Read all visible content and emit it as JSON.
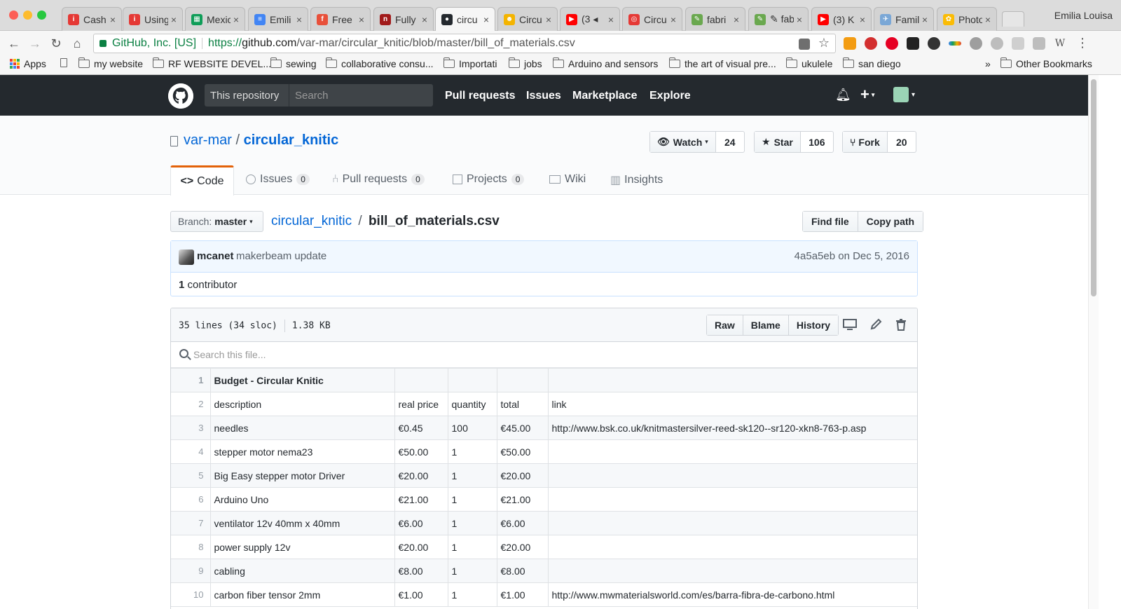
{
  "browser": {
    "profile": "Emilia Louisa",
    "tabs": [
      {
        "label": "Cash",
        "color": "#e53935",
        "glyph": "i"
      },
      {
        "label": "Using",
        "color": "#e53935",
        "glyph": "i"
      },
      {
        "label": "Mexic",
        "color": "#0f9d58",
        "glyph": "▦"
      },
      {
        "label": "Emili",
        "color": "#4285f4",
        "glyph": "≡"
      },
      {
        "label": "Free",
        "color": "#e8503a",
        "glyph": "f"
      },
      {
        "label": "Fully",
        "color": "#a11a1a",
        "glyph": "n"
      },
      {
        "label": "circu",
        "color": "#24292e",
        "glyph": "●",
        "active": true
      },
      {
        "label": "Circu",
        "color": "#f4b400",
        "glyph": "☻"
      },
      {
        "label": "(3 ◂",
        "color": "#ff0000",
        "glyph": "▶"
      },
      {
        "label": "Circu",
        "color": "#e53935",
        "glyph": "◎"
      },
      {
        "label": "fabri",
        "color": "#6aa84f",
        "glyph": "✎"
      },
      {
        "label": "✎ fab",
        "color": "#6aa84f",
        "glyph": "✎"
      },
      {
        "label": "(3) K",
        "color": "#ff0000",
        "glyph": "▶"
      },
      {
        "label": "Famil",
        "color": "#7aa7d6",
        "glyph": "✈"
      },
      {
        "label": "Photo",
        "color": "#fbbc05",
        "glyph": "✿"
      }
    ],
    "secure_label": "GitHub, Inc. [US]",
    "url_scheme": "https://",
    "url_host": "github.com",
    "url_path": "/var-mar/circular_knitic/blob/master/bill_of_materials.csv",
    "bookmarks": [
      "Apps",
      "my website",
      "RF WEBSITE DEVEL...",
      "sewing",
      "collaborative consu...",
      "Importati",
      "jobs",
      "Arduino and sensors",
      "the art of visual pre...",
      "ukulele",
      "san diego"
    ],
    "bookmarks_more": "»",
    "other_bookmarks": "Other Bookmarks"
  },
  "github": {
    "scope": "This repository",
    "search_placeholder": "Search",
    "nav": [
      "Pull requests",
      "Issues",
      "Marketplace",
      "Explore"
    ]
  },
  "repo": {
    "owner": "var-mar",
    "separator": "/",
    "name": "circular_knitic",
    "watch_label": "Watch",
    "watch_count": "24",
    "star_label": "Star",
    "star_count": "106",
    "fork_label": "Fork",
    "fork_count": "20",
    "tabs": {
      "code": "Code",
      "issues": "Issues",
      "issues_count": "0",
      "pulls": "Pull requests",
      "pulls_count": "0",
      "projects": "Projects",
      "projects_count": "0",
      "wiki": "Wiki",
      "insights": "Insights"
    }
  },
  "file": {
    "branch_prefix": "Branch:",
    "branch": "master",
    "breadcrumb_repo": "circular_knitic",
    "breadcrumb_sep": "/",
    "filename": "bill_of_materials.csv",
    "find_file": "Find file",
    "copy_path": "Copy path",
    "commit_author": "mcanet",
    "commit_message": "makerbeam update",
    "commit_sha": "4a5a5eb",
    "commit_date": "on Dec 5, 2016",
    "contributors_count": "1",
    "contributors_label": "contributor",
    "lines_info": "35 lines (34 sloc)",
    "size": "1.38 KB",
    "raw": "Raw",
    "blame": "Blame",
    "history": "History",
    "search_placeholder": "Search this file..."
  },
  "csv": {
    "rows": [
      [
        "1",
        "Budget - Circular Knitic",
        "",
        "",
        "",
        ""
      ],
      [
        "2",
        "description",
        "real price",
        "quantity",
        "total",
        "link"
      ],
      [
        "3",
        "needles",
        "€0.45",
        "100",
        "€45.00",
        "http://www.bsk.co.uk/knitmastersilver-reed-sk120--sr120-xkn8-763-p.asp"
      ],
      [
        "4",
        "stepper motor nema23",
        "€50.00",
        "1",
        "€50.00",
        ""
      ],
      [
        "5",
        "Big Easy stepper motor Driver",
        "€20.00",
        "1",
        "€20.00",
        ""
      ],
      [
        "6",
        "Arduino Uno",
        "€21.00",
        "1",
        "€21.00",
        ""
      ],
      [
        "7",
        "ventilator 12v 40mm x 40mm",
        "€6.00",
        "1",
        "€6.00",
        ""
      ],
      [
        "8",
        "power supply 12v",
        "€20.00",
        "1",
        "€20.00",
        ""
      ],
      [
        "9",
        "cabling",
        "€8.00",
        "1",
        "€8.00",
        ""
      ],
      [
        "10",
        "carbon fiber tensor 2mm",
        "€1.00",
        "1",
        "€1.00",
        "http://www.mwmaterialsworld.com/es/barra-fibra-de-carbono.html"
      ]
    ]
  }
}
